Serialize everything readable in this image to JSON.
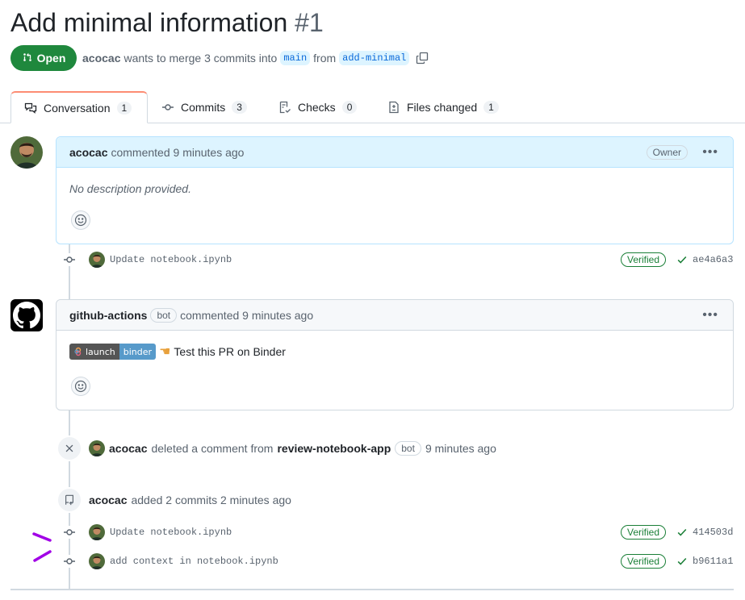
{
  "header": {
    "title": "Add minimal information",
    "number": "#1",
    "state": "Open",
    "author": "acocac",
    "merge_text": "wants to merge 3 commits into",
    "base_branch": "main",
    "from_text": "from",
    "head_branch": "add-minimal"
  },
  "tabs": [
    {
      "label": "Conversation",
      "count": "1"
    },
    {
      "label": "Commits",
      "count": "3"
    },
    {
      "label": "Checks",
      "count": "0"
    },
    {
      "label": "Files changed",
      "count": "1"
    }
  ],
  "comment1": {
    "author": "acocac",
    "action": "commented 9 minutes ago",
    "role": "Owner",
    "body": "No description provided."
  },
  "commit1": {
    "message": "Update notebook.ipynb",
    "verified": "Verified",
    "sha": "ae4a6a3"
  },
  "comment2": {
    "author": "github-actions",
    "bot": "bot",
    "action": "commented 9 minutes ago",
    "badge_left": "launch",
    "badge_right": "binder",
    "body": "Test this PR on Binder"
  },
  "event_deleted": {
    "actor": "acocac",
    "text": "deleted a comment from",
    "target": "review-notebook-app",
    "bot": "bot",
    "time": "9 minutes ago"
  },
  "event_added": {
    "actor": "acocac",
    "text": "added 2 commits 2 minutes ago"
  },
  "commits": [
    {
      "message": "Update notebook.ipynb",
      "verified": "Verified",
      "sha": "414503d"
    },
    {
      "message": "add context in notebook.ipynb",
      "verified": "Verified",
      "sha": "b9611a1"
    }
  ],
  "colors": {
    "open_green": "#1f883d",
    "link_blue": "#0969da",
    "annotation_purple": "#a100e6"
  }
}
